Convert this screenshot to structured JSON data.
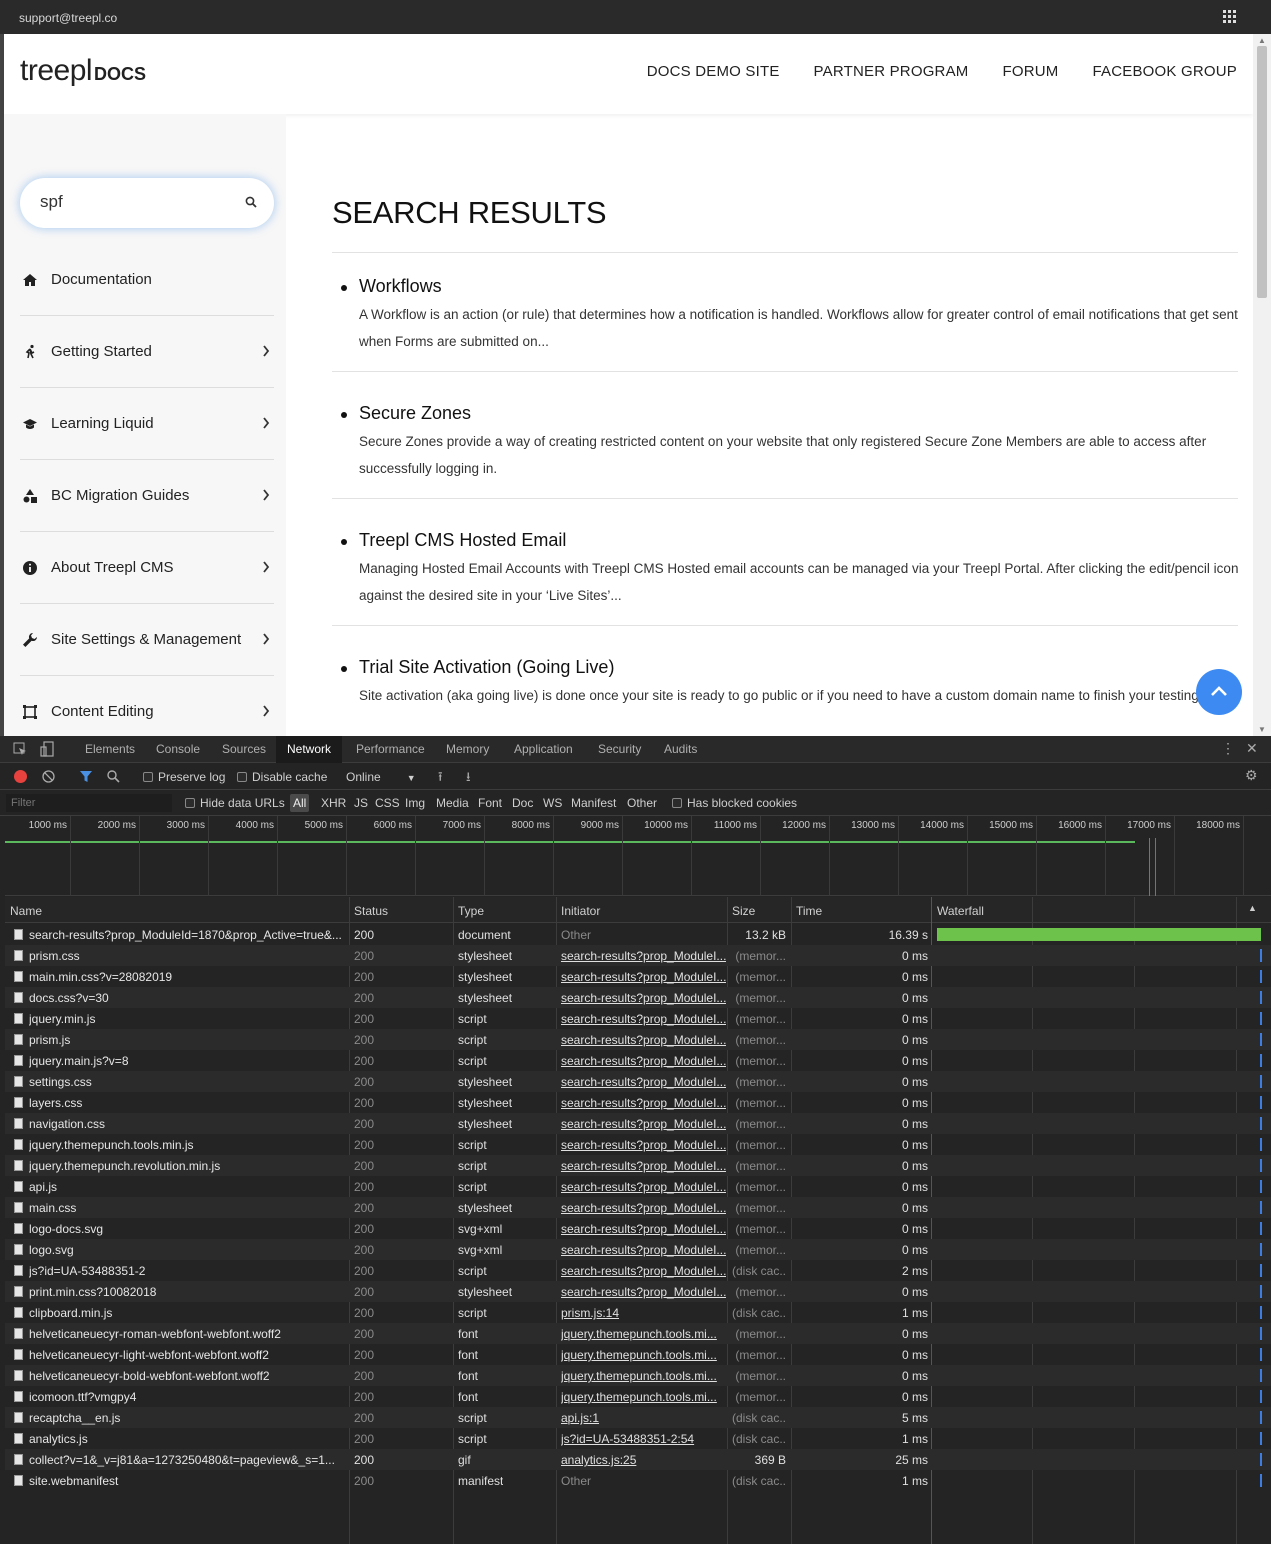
{
  "topbar": {
    "email": "support@treepl.co"
  },
  "logo": {
    "brand": "treepl",
    "suffix": "DOCS"
  },
  "nav": [
    "DOCS DEMO SITE",
    "PARTNER PROGRAM",
    "FORUM",
    "FACEBOOK GROUP"
  ],
  "search": {
    "value": "spf"
  },
  "sidebar": {
    "items": [
      {
        "label": "Documentation",
        "icon": "home-icon",
        "chevron": false
      },
      {
        "label": "Getting Started",
        "icon": "running-person-icon",
        "chevron": true
      },
      {
        "label": "Learning Liquid",
        "icon": "graduation-cap-icon",
        "chevron": true
      },
      {
        "label": "BC Migration Guides",
        "icon": "shapes-icon",
        "chevron": true
      },
      {
        "label": "About Treepl CMS",
        "icon": "info-icon",
        "chevron": true
      },
      {
        "label": "Site Settings & Management",
        "icon": "wrench-icon",
        "chevron": true
      },
      {
        "label": "Content Editing",
        "icon": "frame-icon",
        "chevron": true
      }
    ]
  },
  "main": {
    "title": "SEARCH RESULTS",
    "results": [
      {
        "title": "Workflows",
        "desc": "A Workflow is an action (or rule) that determines how a notification is handled. Workflows allow for greater control of email notifications that get sent when Forms are submitted on..."
      },
      {
        "title": "Secure Zones",
        "desc": "Secure Zones provide a way of creating restricted content on your website that only registered Secure Zone Members are able to access after successfully logging in."
      },
      {
        "title": "Treepl CMS Hosted Email",
        "desc": "Managing Hosted Email Accounts with Treepl CMS Hosted email accounts can be managed via your Treepl Portal. After clicking the edit/pencil icon against the desired site in your ‘Live Sites’..."
      },
      {
        "title": "Trial Site Activation (Going Live)",
        "desc": "Site activation (aka going live) is done once your site is ready to go public or if you need to have a custom domain name to finish your testing. It..."
      }
    ]
  },
  "devtools": {
    "tabs": [
      "Elements",
      "Console",
      "Sources",
      "Network",
      "Performance",
      "Memory",
      "Application",
      "Security",
      "Audits"
    ],
    "active_tab": "Network",
    "toolbar": {
      "preserve_log": "Preserve log",
      "disable_cache": "Disable cache",
      "throttle": "Online"
    },
    "filter": {
      "placeholder": "Filter",
      "hide_data_urls": "Hide data URLs",
      "types": [
        "All",
        "XHR",
        "JS",
        "CSS",
        "Img",
        "Media",
        "Font",
        "Doc",
        "WS",
        "Manifest",
        "Other"
      ],
      "has_blocked_cookies": "Has blocked cookies"
    },
    "timeline_ticks": [
      "1000 ms",
      "2000 ms",
      "3000 ms",
      "4000 ms",
      "5000 ms",
      "6000 ms",
      "7000 ms",
      "8000 ms",
      "9000 ms",
      "10000 ms",
      "11000 ms",
      "12000 ms",
      "13000 ms",
      "14000 ms",
      "15000 ms",
      "16000 ms",
      "17000 ms",
      "18000 ms"
    ],
    "columns": [
      "Name",
      "Status",
      "Type",
      "Initiator",
      "Size",
      "Time",
      "Waterfall"
    ],
    "rows": [
      {
        "name": "search-results?prop_ModuleId=1870&prop_Active=true&...",
        "status": "200",
        "type": "document",
        "initiator": "Other",
        "size": "13.2 kB",
        "time": "16.39 s"
      },
      {
        "name": "prism.css",
        "status": "200",
        "type": "stylesheet",
        "initiator": "search-results?prop_ModuleI...",
        "size": "(memor...",
        "time": "0 ms"
      },
      {
        "name": "main.min.css?v=28082019",
        "status": "200",
        "type": "stylesheet",
        "initiator": "search-results?prop_ModuleI...",
        "size": "(memor...",
        "time": "0 ms"
      },
      {
        "name": "docs.css?v=30",
        "status": "200",
        "type": "stylesheet",
        "initiator": "search-results?prop_ModuleI...",
        "size": "(memor...",
        "time": "0 ms"
      },
      {
        "name": "jquery.min.js",
        "status": "200",
        "type": "script",
        "initiator": "search-results?prop_ModuleI...",
        "size": "(memor...",
        "time": "0 ms"
      },
      {
        "name": "prism.js",
        "status": "200",
        "type": "script",
        "initiator": "search-results?prop_ModuleI...",
        "size": "(memor...",
        "time": "0 ms"
      },
      {
        "name": "jquery.main.js?v=8",
        "status": "200",
        "type": "script",
        "initiator": "search-results?prop_ModuleI...",
        "size": "(memor...",
        "time": "0 ms"
      },
      {
        "name": "settings.css",
        "status": "200",
        "type": "stylesheet",
        "initiator": "search-results?prop_ModuleI...",
        "size": "(memor...",
        "time": "0 ms"
      },
      {
        "name": "layers.css",
        "status": "200",
        "type": "stylesheet",
        "initiator": "search-results?prop_ModuleI...",
        "size": "(memor...",
        "time": "0 ms"
      },
      {
        "name": "navigation.css",
        "status": "200",
        "type": "stylesheet",
        "initiator": "search-results?prop_ModuleI...",
        "size": "(memor...",
        "time": "0 ms"
      },
      {
        "name": "jquery.themepunch.tools.min.js",
        "status": "200",
        "type": "script",
        "initiator": "search-results?prop_ModuleI...",
        "size": "(memor...",
        "time": "0 ms"
      },
      {
        "name": "jquery.themepunch.revolution.min.js",
        "status": "200",
        "type": "script",
        "initiator": "search-results?prop_ModuleI...",
        "size": "(memor...",
        "time": "0 ms"
      },
      {
        "name": "api.js",
        "status": "200",
        "type": "script",
        "initiator": "search-results?prop_ModuleI...",
        "size": "(memor...",
        "time": "0 ms"
      },
      {
        "name": "main.css",
        "status": "200",
        "type": "stylesheet",
        "initiator": "search-results?prop_ModuleI...",
        "size": "(memor...",
        "time": "0 ms"
      },
      {
        "name": "logo-docs.svg",
        "status": "200",
        "type": "svg+xml",
        "initiator": "search-results?prop_ModuleI...",
        "size": "(memor...",
        "time": "0 ms"
      },
      {
        "name": "logo.svg",
        "status": "200",
        "type": "svg+xml",
        "initiator": "search-results?prop_ModuleI...",
        "size": "(memor...",
        "time": "0 ms"
      },
      {
        "name": "js?id=UA-53488351-2",
        "status": "200",
        "type": "script",
        "initiator": "search-results?prop_ModuleI...",
        "size": "(disk cac...",
        "time": "2 ms"
      },
      {
        "name": "print.min.css?10082018",
        "status": "200",
        "type": "stylesheet",
        "initiator": "search-results?prop_ModuleI...",
        "size": "(memor...",
        "time": "0 ms"
      },
      {
        "name": "clipboard.min.js",
        "status": "200",
        "type": "script",
        "initiator": "prism.js:14",
        "size": "(disk cac...",
        "time": "1 ms"
      },
      {
        "name": "helveticaneuecyr-roman-webfont-webfont.woff2",
        "status": "200",
        "type": "font",
        "initiator": "jquery.themepunch.tools.mi...",
        "size": "(memor...",
        "time": "0 ms"
      },
      {
        "name": "helveticaneuecyr-light-webfont-webfont.woff2",
        "status": "200",
        "type": "font",
        "initiator": "jquery.themepunch.tools.mi...",
        "size": "(memor...",
        "time": "0 ms"
      },
      {
        "name": "helveticaneuecyr-bold-webfont-webfont.woff2",
        "status": "200",
        "type": "font",
        "initiator": "jquery.themepunch.tools.mi...",
        "size": "(memor...",
        "time": "0 ms"
      },
      {
        "name": "icomoon.ttf?vmgpy4",
        "status": "200",
        "type": "font",
        "initiator": "jquery.themepunch.tools.mi...",
        "size": "(memor...",
        "time": "0 ms"
      },
      {
        "name": "recaptcha__en.js",
        "status": "200",
        "type": "script",
        "initiator": "api.js:1",
        "size": "(disk cac...",
        "time": "5 ms"
      },
      {
        "name": "analytics.js",
        "status": "200",
        "type": "script",
        "initiator": "js?id=UA-53488351-2:54",
        "size": "(disk cac...",
        "time": "1 ms"
      },
      {
        "name": "collect?v=1&_v=j81&a=1273250480&t=pageview&_s=1...",
        "status": "200",
        "type": "gif",
        "initiator": "analytics.js:25",
        "size": "369 B",
        "time": "25 ms"
      },
      {
        "name": "site.webmanifest",
        "status": "200",
        "type": "manifest",
        "initiator": "Other",
        "size": "(disk cac...",
        "time": "1 ms"
      }
    ]
  }
}
